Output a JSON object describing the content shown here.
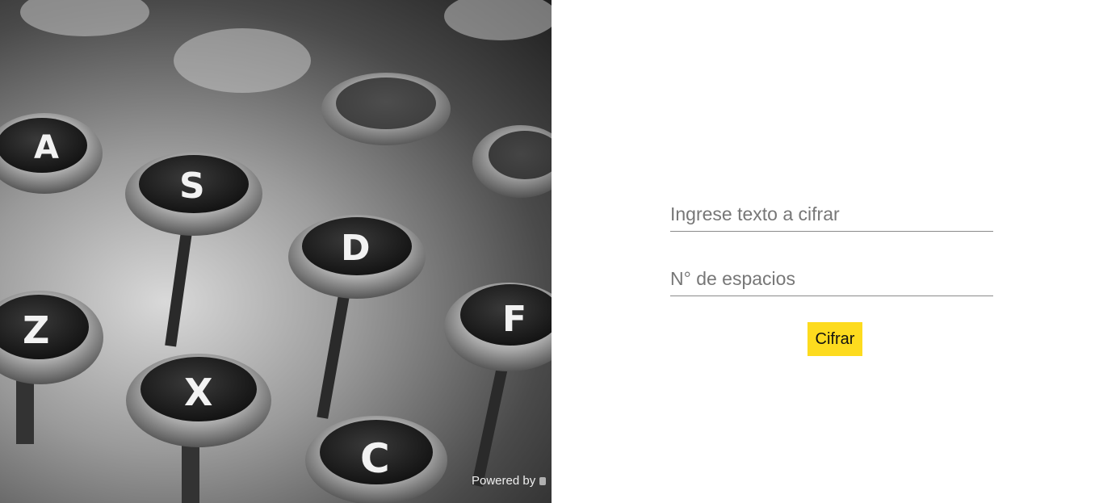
{
  "photo": {
    "keys": [
      "A",
      "S",
      "D",
      "F",
      "Z",
      "X",
      "C"
    ],
    "powered_label": "Powered by"
  },
  "form": {
    "text_field": {
      "placeholder": "Ingrese texto a cifrar",
      "value": ""
    },
    "spaces_field": {
      "placeholder": "N° de espacios",
      "value": ""
    },
    "submit_label": "Cifrar",
    "accent_color": "#fddb1e"
  }
}
